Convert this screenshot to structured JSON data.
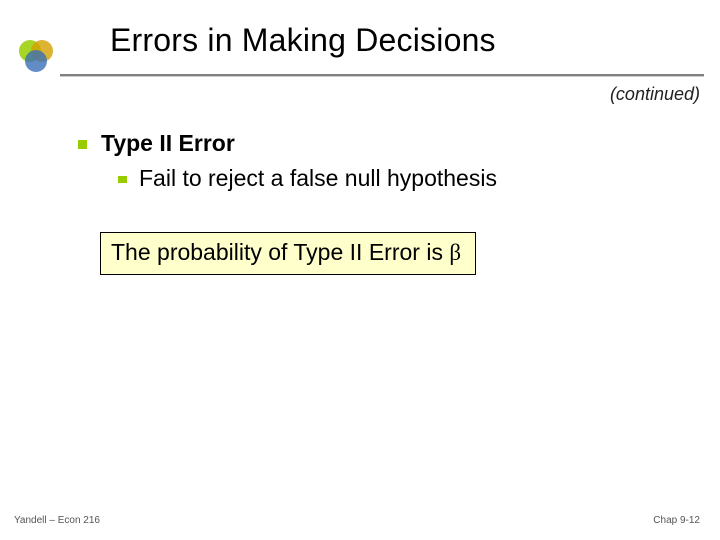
{
  "title": "Errors in Making Decisions",
  "continued": "(continued)",
  "bullets": {
    "level1": "Type II Error",
    "level2": "Fail to reject a false null hypothesis"
  },
  "callout": {
    "prefix": "The probability of Type II Error is  ",
    "symbol": "β"
  },
  "footer": {
    "left": "Yandell – Econ 216",
    "right": "Chap 9-12"
  }
}
